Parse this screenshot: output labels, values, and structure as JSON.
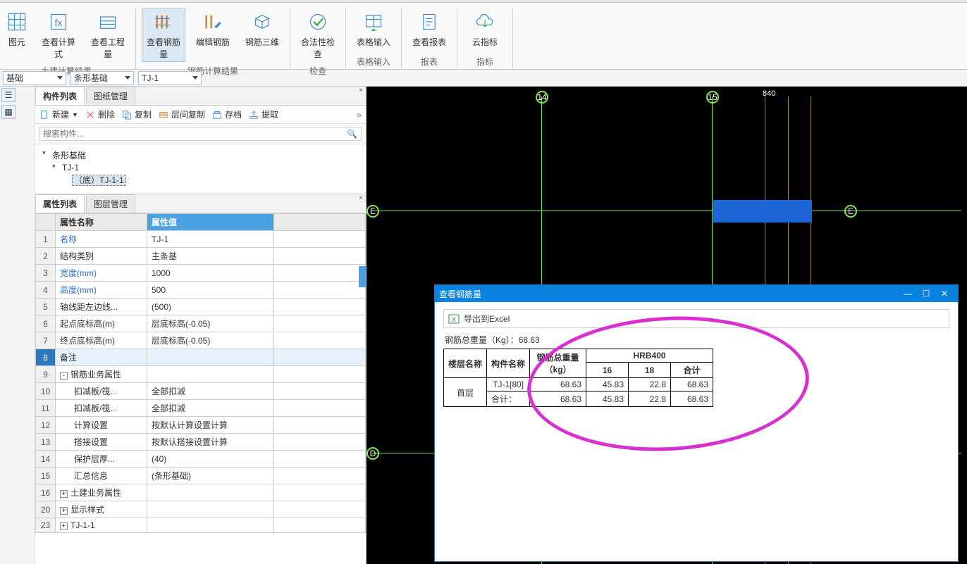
{
  "ribbon": {
    "yutuyuan": "图元",
    "chakanjisuanshi": "查看计算式",
    "chakangchengliang": "查看工程量",
    "chakangangjinliang": "查看钢筋量",
    "bianjigangjin": "编辑钢筋",
    "gangjinsanwei": "钢筋三维",
    "hefaxingjiancha": "合法性检查",
    "biaogeshuru": "表格输入",
    "chakanbaobiao": "查看报表",
    "yunzhibiao": "云指标",
    "group_tujian": "土建计算结果",
    "group_gangjin": "钢筋计算结果",
    "group_jiancha": "检查",
    "group_biaoge": "表格输入",
    "group_baobiao": "报表",
    "group_zhibiao": "指标"
  },
  "subbar": {
    "sel1": "基础",
    "sel2": "条形基础",
    "sel3": "TJ-1"
  },
  "panel1": {
    "tab1": "构件列表",
    "tab2": "图纸管理",
    "btn_new": "新建",
    "btn_delete": "删除",
    "btn_copy": "复制",
    "btn_floorcopy": "层间复制",
    "btn_archive": "存档",
    "btn_extract": "提取",
    "search_ph": "搜索构件...",
    "tree_root": "条形基础",
    "tree_child": "TJ-1",
    "tree_leaf": "（底）TJ-1-1"
  },
  "panel2": {
    "tab1": "属性列表",
    "tab2": "图层管理",
    "col_name": "属性名称",
    "col_value": "属性值",
    "rows": [
      {
        "n": "1",
        "name": "名称",
        "value": "TJ-1",
        "link": true
      },
      {
        "n": "2",
        "name": "结构类别",
        "value": "主条基"
      },
      {
        "n": "3",
        "name": "宽度(mm)",
        "value": "1000",
        "link": true
      },
      {
        "n": "4",
        "name": "高度(mm)",
        "value": "500",
        "link": true
      },
      {
        "n": "5",
        "name": "轴线距左边线...",
        "value": "(500)"
      },
      {
        "n": "6",
        "name": "起点底标高(m)",
        "value": "层底标高(-0.05)"
      },
      {
        "n": "7",
        "name": "终点底标高(m)",
        "value": "层底标高(-0.05)"
      },
      {
        "n": "8",
        "name": "备注",
        "value": "",
        "sel": true
      },
      {
        "n": "9",
        "name": "钢筋业务属性",
        "value": "",
        "exp": "-"
      },
      {
        "n": "10",
        "name": "扣减板/筏...",
        "value": "全部扣减",
        "indent": true
      },
      {
        "n": "11",
        "name": "扣减板/筏...",
        "value": "全部扣减",
        "indent": true
      },
      {
        "n": "12",
        "name": "计算设置",
        "value": "按默认计算设置计算",
        "indent": true
      },
      {
        "n": "13",
        "name": "搭接设置",
        "value": "按默认搭接设置计算",
        "indent": true
      },
      {
        "n": "14",
        "name": "保护层厚...",
        "value": "(40)",
        "indent": true
      },
      {
        "n": "15",
        "name": "汇总信息",
        "value": "(条形基础)",
        "indent": true
      },
      {
        "n": "16",
        "name": "土建业务属性",
        "value": "",
        "exp": "+"
      },
      {
        "n": "20",
        "name": "显示样式",
        "value": "",
        "exp": "+"
      },
      {
        "n": "23",
        "name": "TJ-1-1",
        "value": "",
        "exp": "+"
      }
    ]
  },
  "canvas": {
    "label14": "14",
    "label15": "15",
    "labelE_left": "E",
    "labelE_right": "E",
    "labelD": "D",
    "dim": "840"
  },
  "popup": {
    "title": "查看钢筋量",
    "export": "导出到Excel",
    "total_prefix": "钢筋总重量（Kg）：",
    "total_value": "68.63",
    "h_floor": "楼层名称",
    "h_comp": "构件名称",
    "h_weight_top": "钢筋总重量",
    "h_weight_unit": "（kg）",
    "h_hrb": "HRB400",
    "h_16": "16",
    "h_18": "18",
    "h_sum": "合计",
    "r_floor": "首层",
    "r_comp1": "TJ-1[80]",
    "r_total": "合计：",
    "v_w1": "68.63",
    "v_16_1": "45.83",
    "v_18_1": "22.8",
    "v_s1": "68.63",
    "v_w2": "68.63",
    "v_16_2": "45.83",
    "v_18_2": "22.8",
    "v_s2": "68.63"
  }
}
